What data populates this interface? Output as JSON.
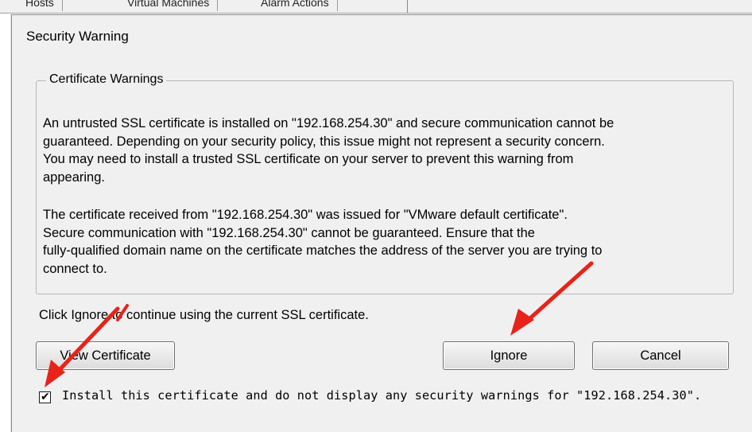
{
  "background_window": {
    "tabs": [
      "Hosts",
      "Virtual Machines",
      "Alarm Actions"
    ]
  },
  "dialog": {
    "title": "Security Warning",
    "group_label": "Certificate Warnings",
    "warning_1": [
      "An untrusted SSL certificate is installed on \"192.168.254.30\" and secure communication cannot be",
      "guaranteed.  Depending on your security policy, this issue might not represent a security concern.",
      " You may need to install a trusted SSL certificate on your server to prevent this warning from",
      "appearing."
    ],
    "warning_2": [
      "The certificate received from \"192.168.254.30\" was issued for \"VMware default certificate\".",
      "Secure communication with \"192.168.254.30\" cannot be guaranteed.  Ensure that the",
      "fully-qualified domain name on the certificate matches the address of the server you are trying to",
      "connect to."
    ],
    "hint": "Click Ignore to continue using the current SSL certificate.",
    "buttons": {
      "view_certificate": "View Certificate",
      "ignore": "Ignore",
      "cancel": "Cancel"
    },
    "checkbox": {
      "checked": true,
      "mark": "✔",
      "label": "Install this certificate and do not display any security warnings for \"192.168.254.30\"."
    }
  },
  "colors": {
    "dialog_bg": "#f0f0f0",
    "annotation_arrow": "#e8231a"
  },
  "icons": [
    "check-icon",
    "annotation-arrow-icon"
  ]
}
